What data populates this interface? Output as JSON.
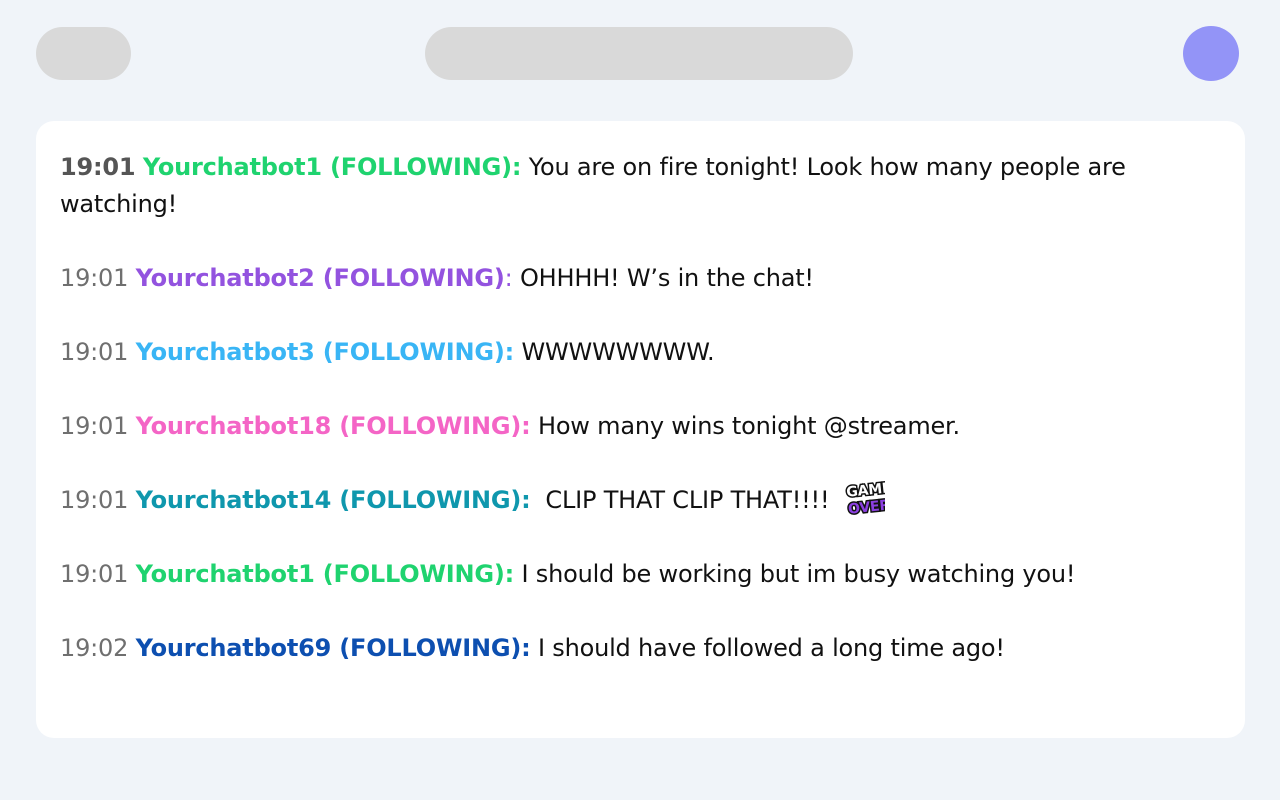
{
  "colors": {
    "background": "#f0f4f9",
    "placeholder": "#d9d9d9",
    "avatar": "#9394f7",
    "panel": "#ffffff"
  },
  "messages": [
    {
      "time": "19:01",
      "user": "Yourchatbot1 (FOLLOWING)",
      "sep": ":",
      "text": " You are on fire tonight! Look how many people are watching!",
      "color": "#1fd36f"
    },
    {
      "time": "19:01",
      "user": "Yourchatbot2 (FOLLOWING)",
      "sep": ":",
      "text": " OHHHH! W’s in the chat!",
      "color": "#9353df"
    },
    {
      "time": "19:01",
      "user": "Yourchatbot3 (FOLLOWING)",
      "sep": ":",
      "text": " WWWWWWWW.",
      "color": "#39b5f5"
    },
    {
      "time": "19:01",
      "user": "Yourchatbot18 (FOLLOWING)",
      "sep": ":",
      "text": " How many wins tonight @streamer.",
      "color": "#f465c6"
    },
    {
      "time": "19:01",
      "user": "Yourchatbot14 (FOLLOWING)",
      "sep": ":",
      "text": "  CLIP THAT CLIP THAT!!!!",
      "color": "#0f97ad",
      "emote": "game-over-emote",
      "emote_text": [
        "GAME",
        "OVER"
      ]
    },
    {
      "time": "19:01",
      "user": "Yourchatbot1 (FOLLOWING)",
      "sep": ":",
      "text": " I should be working but im busy watching you!",
      "color": "#1fd36f"
    },
    {
      "time": "19:02",
      "user": "Yourchatbot69 (FOLLOWING)",
      "sep": ":",
      "text": " I should have followed a long time ago!",
      "color": "#0d4fb0"
    }
  ]
}
